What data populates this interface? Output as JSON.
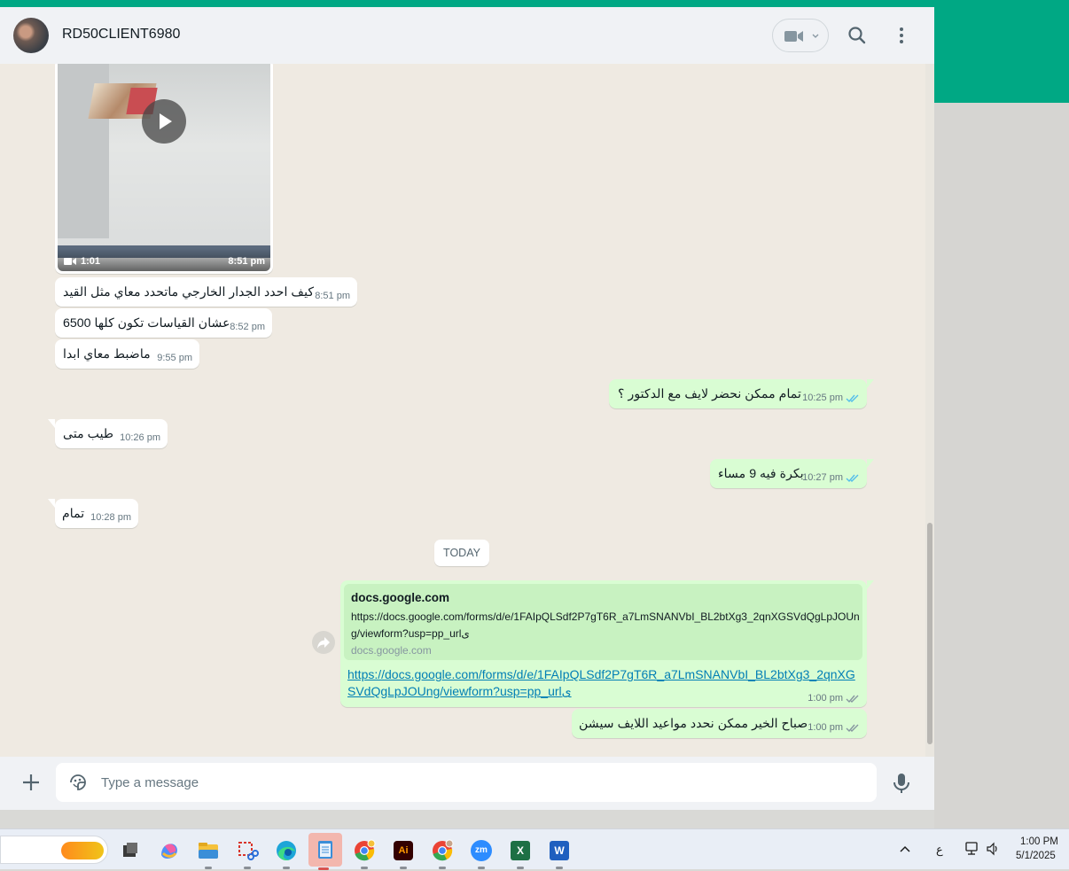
{
  "header": {
    "contact_name": "RD50CLIENT6980",
    "video_call_icon": "video-camera-icon",
    "search_icon": "search-icon",
    "menu_icon": "more-vertical-icon"
  },
  "video_message": {
    "duration": "1:01",
    "time": "8:51 pm"
  },
  "messages": [
    {
      "text": "كيف احدد الجدار الخارجي ماتحدد معاي مثل القيد",
      "time": "8:51 pm",
      "direction": "in"
    },
    {
      "text": "عشان القياسات تكون كلها 6500",
      "time": "8:52 pm",
      "direction": "in"
    },
    {
      "text": "ماضبط معاي ابدا",
      "time": "9:55 pm",
      "direction": "in"
    },
    {
      "text": "تمام ممكن نحضر لايف مع الدكتور ؟",
      "time": "10:25 pm",
      "direction": "out"
    },
    {
      "text": "طيب متى",
      "time": "10:26 pm",
      "direction": "in"
    },
    {
      "text": "بكرة فيه 9 مساء",
      "time": "10:27 pm",
      "direction": "out"
    },
    {
      "text": "تمام",
      "time": "10:28 pm",
      "direction": "in"
    }
  ],
  "date_divider": "TODAY",
  "link_message": {
    "preview_title": "docs.google.com",
    "preview_description": "https://docs.google.com/forms/d/e/1FAIpQLSdf2P7gT6R_a7LmSNANVbI_BL2btXg3_2qnXGSVdQgLpJOUng/viewform?usp=pp_urlى",
    "preview_domain": "docs.google.com",
    "url": "https://docs.google.com/forms/d/e/1FAIpQLSdf2P7gT6R_a7LmSNANVbI_BL2btXg3_2qnXGSVdQgLpJOUng/viewform?usp=pp_urlى",
    "time": "1:00 pm"
  },
  "last_message": {
    "text": "صباح الخير ممكن نحدد مواعيد اللايف سيشن",
    "time": "1:00 pm"
  },
  "composer": {
    "placeholder": "Type a message"
  },
  "taskbar": {
    "apps": [
      "task-view",
      "copilot",
      "file-explorer",
      "snipping-tool",
      "edge",
      "notepad",
      "chrome",
      "illustrator",
      "chrome-profile",
      "zoom",
      "excel",
      "word"
    ],
    "language": "ع",
    "time": "1:00 PM",
    "date": "5/1/2025",
    "illustrator_label": "Ai",
    "zoom_label": "zm",
    "excel_label": "X",
    "word_label": "W"
  },
  "colors": {
    "accent": "#00a884",
    "outgoing_bubble": "#d9fdd3",
    "incoming_bubble": "#ffffff",
    "link": "#027eb5",
    "read_tick": "#53bdeb"
  }
}
